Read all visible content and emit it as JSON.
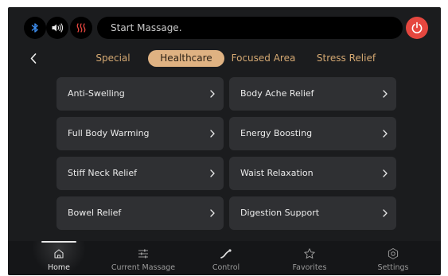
{
  "colors": {
    "background": "#1b1c1e",
    "card": "#2f3033",
    "accent": "#dfb282",
    "tab_text": "#d4a872",
    "power": "#e5473f",
    "bluetooth": "#3d8ef0",
    "heat": "#e5473f"
  },
  "status_bar": {
    "icons": [
      "bluetooth-icon",
      "volume-icon",
      "heat-icon"
    ],
    "massage_status": "Start Massage.",
    "power_icon": "power-icon"
  },
  "tabs": [
    {
      "label": "Special",
      "active": false
    },
    {
      "label": "Healthcare",
      "active": true
    },
    {
      "label": "Focused Area",
      "active": false
    },
    {
      "label": "Stress Relief",
      "active": false
    }
  ],
  "programs": [
    {
      "label": "Anti-Swelling"
    },
    {
      "label": "Body Ache Relief"
    },
    {
      "label": "Full Body Warming"
    },
    {
      "label": "Energy Boosting"
    },
    {
      "label": "Stiff Neck Relief"
    },
    {
      "label": "Waist Relaxation"
    },
    {
      "label": "Bowel Relief"
    },
    {
      "label": "Digestion Support"
    }
  ],
  "bottom_nav": [
    {
      "label": "Home",
      "icon": "home-icon",
      "active": true
    },
    {
      "label": "Current Massage",
      "icon": "sliders-icon",
      "active": false
    },
    {
      "label": "Control",
      "icon": "control-icon",
      "active": false
    },
    {
      "label": "Favorites",
      "icon": "star-icon",
      "active": false
    },
    {
      "label": "Settings",
      "icon": "gear-icon",
      "active": false
    }
  ]
}
